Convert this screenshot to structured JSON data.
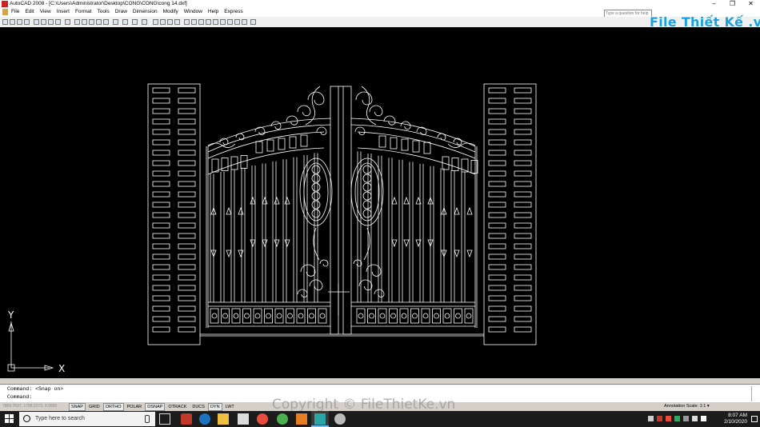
{
  "window": {
    "title": "AutoCAD 2008 - [C:\\Users\\Administrator\\Desktop\\CONG\\CONG\\cong 14.dxf]",
    "controls": [
      "–",
      "❐",
      "✕"
    ]
  },
  "menubar": {
    "items": [
      "File",
      "Edit",
      "View",
      "Insert",
      "Format",
      "Tools",
      "Draw",
      "Dimension",
      "Modify",
      "Window",
      "Help",
      "Express"
    ],
    "help_placeholder": "Type a question for help",
    "doc_controls": [
      "–",
      "❐",
      "✕"
    ]
  },
  "watermark": {
    "logo_text": "File Thiết Kế .vn",
    "copyright": "Copyright © FileThietKe.vn"
  },
  "canvas": {
    "background": "#000000",
    "line_color": "#ffffff",
    "ucs_x_label": "X",
    "ucs_y_label": "Y"
  },
  "command": {
    "line1": "Command:  <Snap on>",
    "line2": "Command:"
  },
  "status": {
    "coords": "7869.7637, 1788.3273, 0.0000",
    "toggles": [
      {
        "label": "SNAP",
        "on": true
      },
      {
        "label": "GRID",
        "on": false
      },
      {
        "label": "ORTHO",
        "on": true
      },
      {
        "label": "POLAR",
        "on": false
      },
      {
        "label": "OSNAP",
        "on": true
      },
      {
        "label": "OTRACK",
        "on": false
      },
      {
        "label": "DUCS",
        "on": false
      },
      {
        "label": "DYN",
        "on": true
      },
      {
        "label": "LWT",
        "on": false
      }
    ],
    "annotation_scale_label": "Annotation Scale:",
    "annotation_scale_value": "1:1"
  },
  "taskbar": {
    "search_placeholder": "Type here to search",
    "time": "8:07 AM",
    "date": "2/10/2020"
  }
}
